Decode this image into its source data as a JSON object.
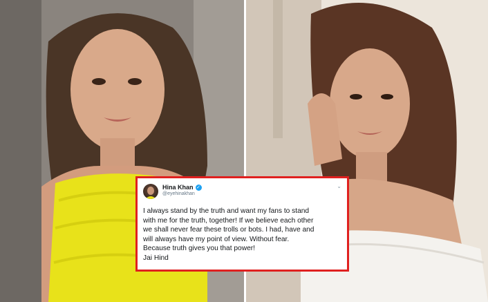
{
  "tweet": {
    "name": "Hina Khan",
    "handle": "@eyehinakhan",
    "body": "I always stand by the truth and want my fans to stand\nwith me for the truth, together! If we believe each other\nwe shall never fear these trolls or bots. I had, have and\nwill always have my point of view. Without fear.\nBecause truth gives you that power!\nJai Hind",
    "verified_icon": "verified-badge-icon",
    "menu_icon": "chevron-down-icon"
  },
  "colors": {
    "tweet_border": "#e0201f",
    "left_dress": "#e8e21a",
    "right_dress": "#f4f2ee",
    "verified": "#1da1f2"
  }
}
